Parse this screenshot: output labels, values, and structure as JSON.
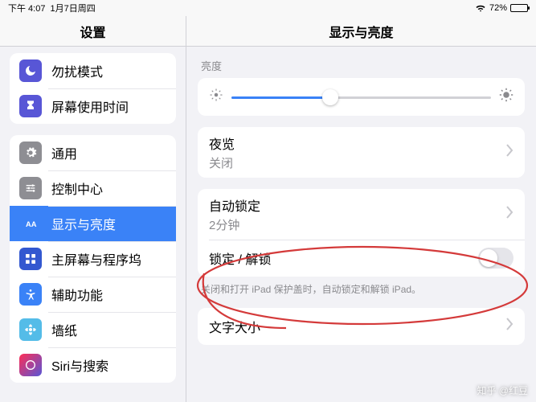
{
  "status": {
    "time": "下午 4:07",
    "date": "1月7日周四",
    "battery_pct": "72%"
  },
  "header": {
    "settings": "设置",
    "detail_title": "显示与亮度"
  },
  "sidebar": {
    "g1": [
      {
        "label": "勿扰模式"
      },
      {
        "label": "屏幕使用时间"
      }
    ],
    "g2": [
      {
        "label": "通用"
      },
      {
        "label": "控制中心"
      },
      {
        "label": "显示与亮度"
      },
      {
        "label": "主屏幕与程序坞"
      },
      {
        "label": "辅助功能"
      },
      {
        "label": "墙纸"
      },
      {
        "label": "Siri与搜索"
      }
    ]
  },
  "detail": {
    "brightness_label": "亮度",
    "brightness_value": 38,
    "night_shift": {
      "title": "夜览",
      "value": "关闭"
    },
    "auto_lock": {
      "title": "自动锁定",
      "value": "2分钟"
    },
    "lock_unlock": {
      "title": "锁定 / 解锁",
      "on": false,
      "footnote": "关闭和打开 iPad 保护盖时，自动锁定和解锁 iPad。"
    },
    "text_size": {
      "title": "文字大小"
    }
  },
  "watermark": "知乎 @红豆"
}
